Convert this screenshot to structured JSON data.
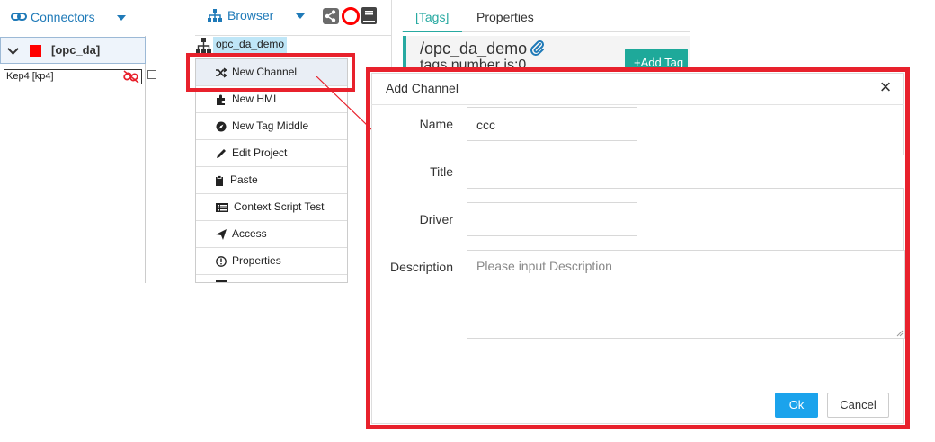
{
  "connectors": {
    "title": "Connectors",
    "group_label": "[opc_da]",
    "item_label": "Kep4 [kp4]"
  },
  "browser": {
    "title": "Browser",
    "project_node": "opc_da_demo"
  },
  "context_menu": {
    "items": [
      {
        "label": "New Channel",
        "icon": "shuffle-icon"
      },
      {
        "label": "New HMI",
        "icon": "puzzle-icon"
      },
      {
        "label": "New Tag Middle",
        "icon": "compass-icon"
      },
      {
        "label": "Edit Project",
        "icon": "pencil-icon"
      },
      {
        "label": "Paste",
        "icon": "clipboard-icon"
      },
      {
        "label": "Context Script Test",
        "icon": "list-icon"
      },
      {
        "label": "Access",
        "icon": "send-icon"
      },
      {
        "label": "Properties",
        "icon": "info-icon"
      }
    ]
  },
  "tabs": {
    "tags_label": "[Tags]",
    "properties_label": "Properties"
  },
  "demo": {
    "title": "/opc_da_demo",
    "tags_number": "tags number is:0",
    "add_tag_label": "+Add Tag"
  },
  "modal": {
    "title": "Add Channel",
    "close_glyph": "×",
    "fields": {
      "name_label": "Name",
      "name_value": "ccc",
      "title_label": "Title",
      "title_value": "",
      "driver_label": "Driver",
      "driver_value": "",
      "description_label": "Description",
      "description_placeholder": "Please input Description"
    },
    "ok_label": "Ok",
    "cancel_label": "Cancel"
  },
  "colors": {
    "accent_blue": "#1f7ab8",
    "teal": "#27a9a1",
    "highlight_red": "#e8212c",
    "ok_blue": "#1ba3ec"
  }
}
